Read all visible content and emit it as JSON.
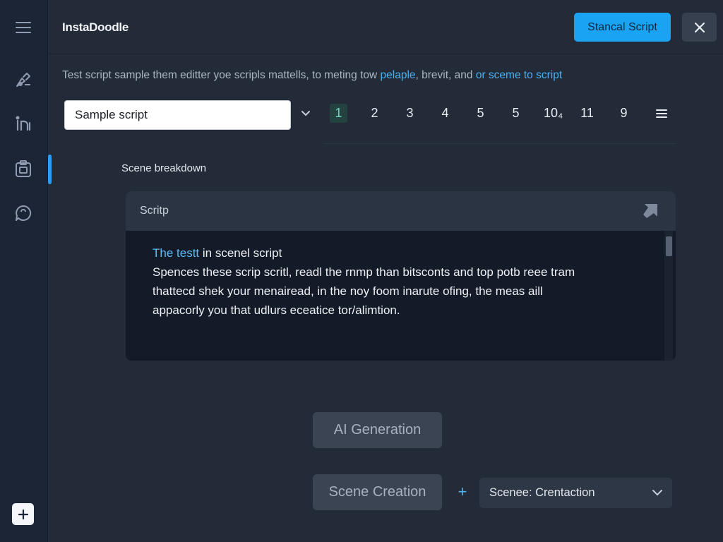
{
  "app": {
    "title": "InstaDoodle"
  },
  "header": {
    "primary_button": "Stancal Script"
  },
  "description": {
    "prefix": "Test script sample them editter yoe scripls mattells, to meting tow ",
    "link1": "pelaple",
    "middle": ", brevit, and ",
    "link2": "or sceme to script"
  },
  "script_selector": {
    "value": "Sample script",
    "pages": [
      "1",
      "2",
      "3",
      "4",
      "5",
      "5",
      "10₄",
      "11",
      "9"
    ],
    "active_page_index": 0
  },
  "section": {
    "label": "Scene breakdown"
  },
  "script_card": {
    "title": "Scritp",
    "line1_accent": "The testt",
    "line1_rest": " in scenel script",
    "line2": "Spences these scrip scritl, readl the rnmp than bitsconts and top  potb reee tram",
    "line3": "thattecd shek your menairead, in the noy foom inarute ofing, the meas aill",
    "line4": "appacorly you that udlurs eceatice tor/alimtion."
  },
  "actions": {
    "ai_generation": "AI Generation",
    "scene_creation": "Scene Creation",
    "plus": "+",
    "scene_dropdown": "Scenee: Crentaction"
  },
  "colors": {
    "accent": "#1aa3f2",
    "background": "#222b37",
    "sidebar": "#1b2535",
    "card": "#131b28"
  }
}
